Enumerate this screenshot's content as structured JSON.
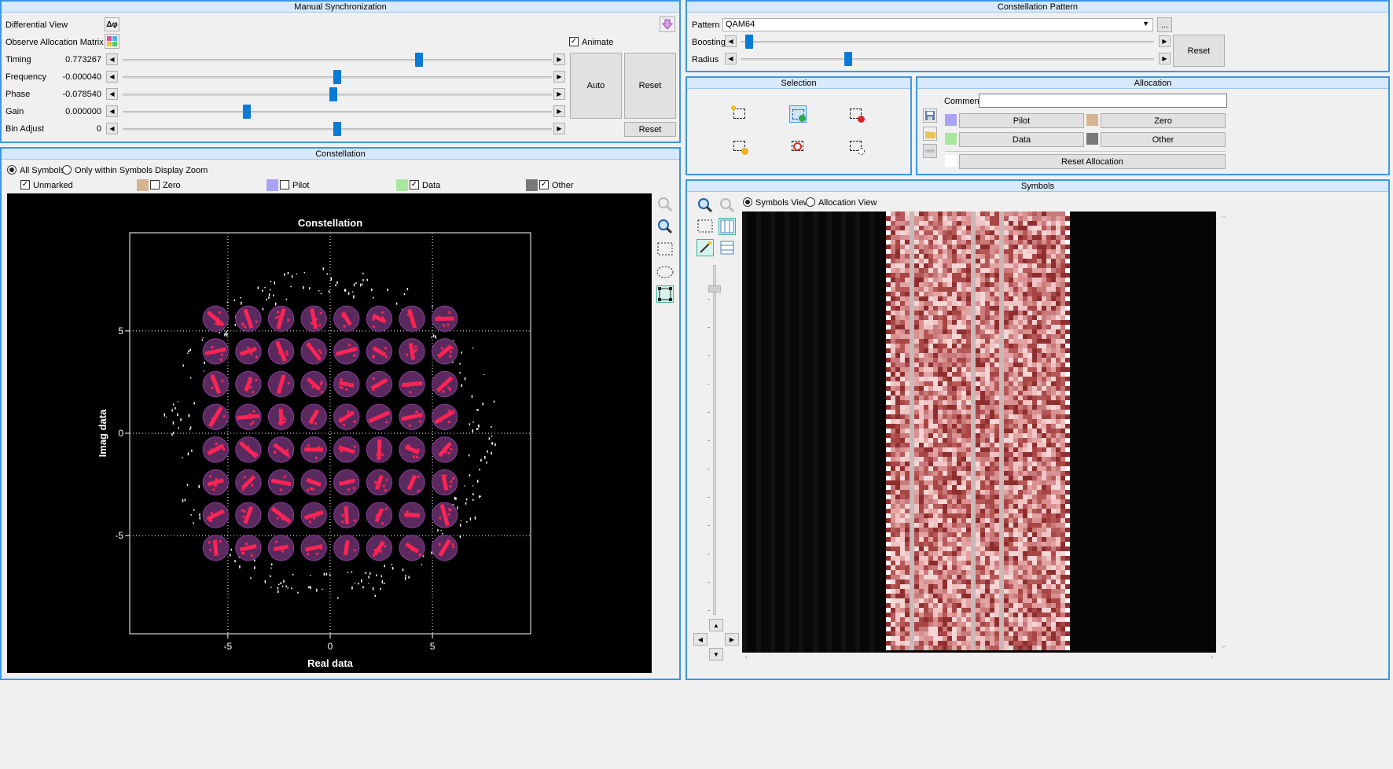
{
  "manual_sync": {
    "title": "Manual Synchronization",
    "differential_view_label": "Differential View",
    "differential_view_button": "Δφ",
    "observe_matrix_label": "Observe Allocation Matrix",
    "animate_label": "Animate",
    "animate_checked": true,
    "rows": [
      {
        "label": "Timing",
        "value": "0.773267",
        "position": 0.69
      },
      {
        "label": "Frequency",
        "value": "-0.000040",
        "position": 0.5
      },
      {
        "label": "Phase",
        "value": "-0.078540",
        "position": 0.49
      },
      {
        "label": "Gain",
        "value": "0.000000",
        "position": 0.29
      },
      {
        "label": "Bin Adjust",
        "value": "0",
        "position": 0.5
      }
    ],
    "auto_label": "Auto",
    "reset_label": "Reset",
    "reset2_label": "Reset"
  },
  "constellation_pattern": {
    "title": "Constellation Pattern",
    "pattern_label": "Pattern",
    "pattern_value": "QAM64",
    "more_label": "...",
    "boosting_label": "Boosting",
    "boosting_position": 0.02,
    "radius_label": "Radius",
    "radius_position": 0.26,
    "reset_label": "Reset"
  },
  "selection": {
    "title": "Selection"
  },
  "allocation": {
    "title": "Allocation",
    "comment_label": "Comment",
    "comment_value": "",
    "pilot_label": "Pilot",
    "zero_label": "Zero",
    "data_label": "Data",
    "other_label": "Other",
    "reset_label": "Reset Allocation",
    "colors": {
      "pilot": "#a9a3f5",
      "zero": "#d6b48f",
      "data": "#a8e6a0",
      "other": "#787878",
      "none": "#ffffff"
    }
  },
  "constellation": {
    "title": "Constellation",
    "radio_all": "All Symbols",
    "radio_zoom": "Only within Symbols Display Zoom",
    "legend": [
      {
        "label": "Unmarked",
        "checked": true,
        "color": "#f0f0f0"
      },
      {
        "label": "Zero",
        "checked": false,
        "color": "#d6b48f"
      },
      {
        "label": "Pilot",
        "checked": false,
        "color": "#a9a3f5"
      },
      {
        "label": "Data",
        "checked": true,
        "color": "#a8e6a0"
      },
      {
        "label": "Other",
        "checked": true,
        "color": "#787878"
      }
    ]
  },
  "symbols": {
    "title": "Symbols",
    "radio_symbols": "Symbols View",
    "radio_allocation": "Allocation View"
  },
  "chart_data": {
    "type": "scatter",
    "title": "Constellation",
    "xlabel": "Real data",
    "ylabel": "Imag data",
    "xlim": [
      -9.8,
      9.8
    ],
    "ylim": [
      -9.8,
      9.8
    ],
    "xticks": [
      -5,
      0,
      5
    ],
    "yticks": [
      5,
      0,
      -5
    ],
    "grid": true,
    "ideal_points": [
      -5.6,
      -4.0,
      -2.4,
      -0.8,
      0.8,
      2.4,
      4.0,
      5.6
    ],
    "target_radius": 0.62,
    "target_color": "#5a2a5e",
    "symbol_color": "#ff2455",
    "noise_color": "#ffffff",
    "noise_ring_radius": 7.5
  }
}
